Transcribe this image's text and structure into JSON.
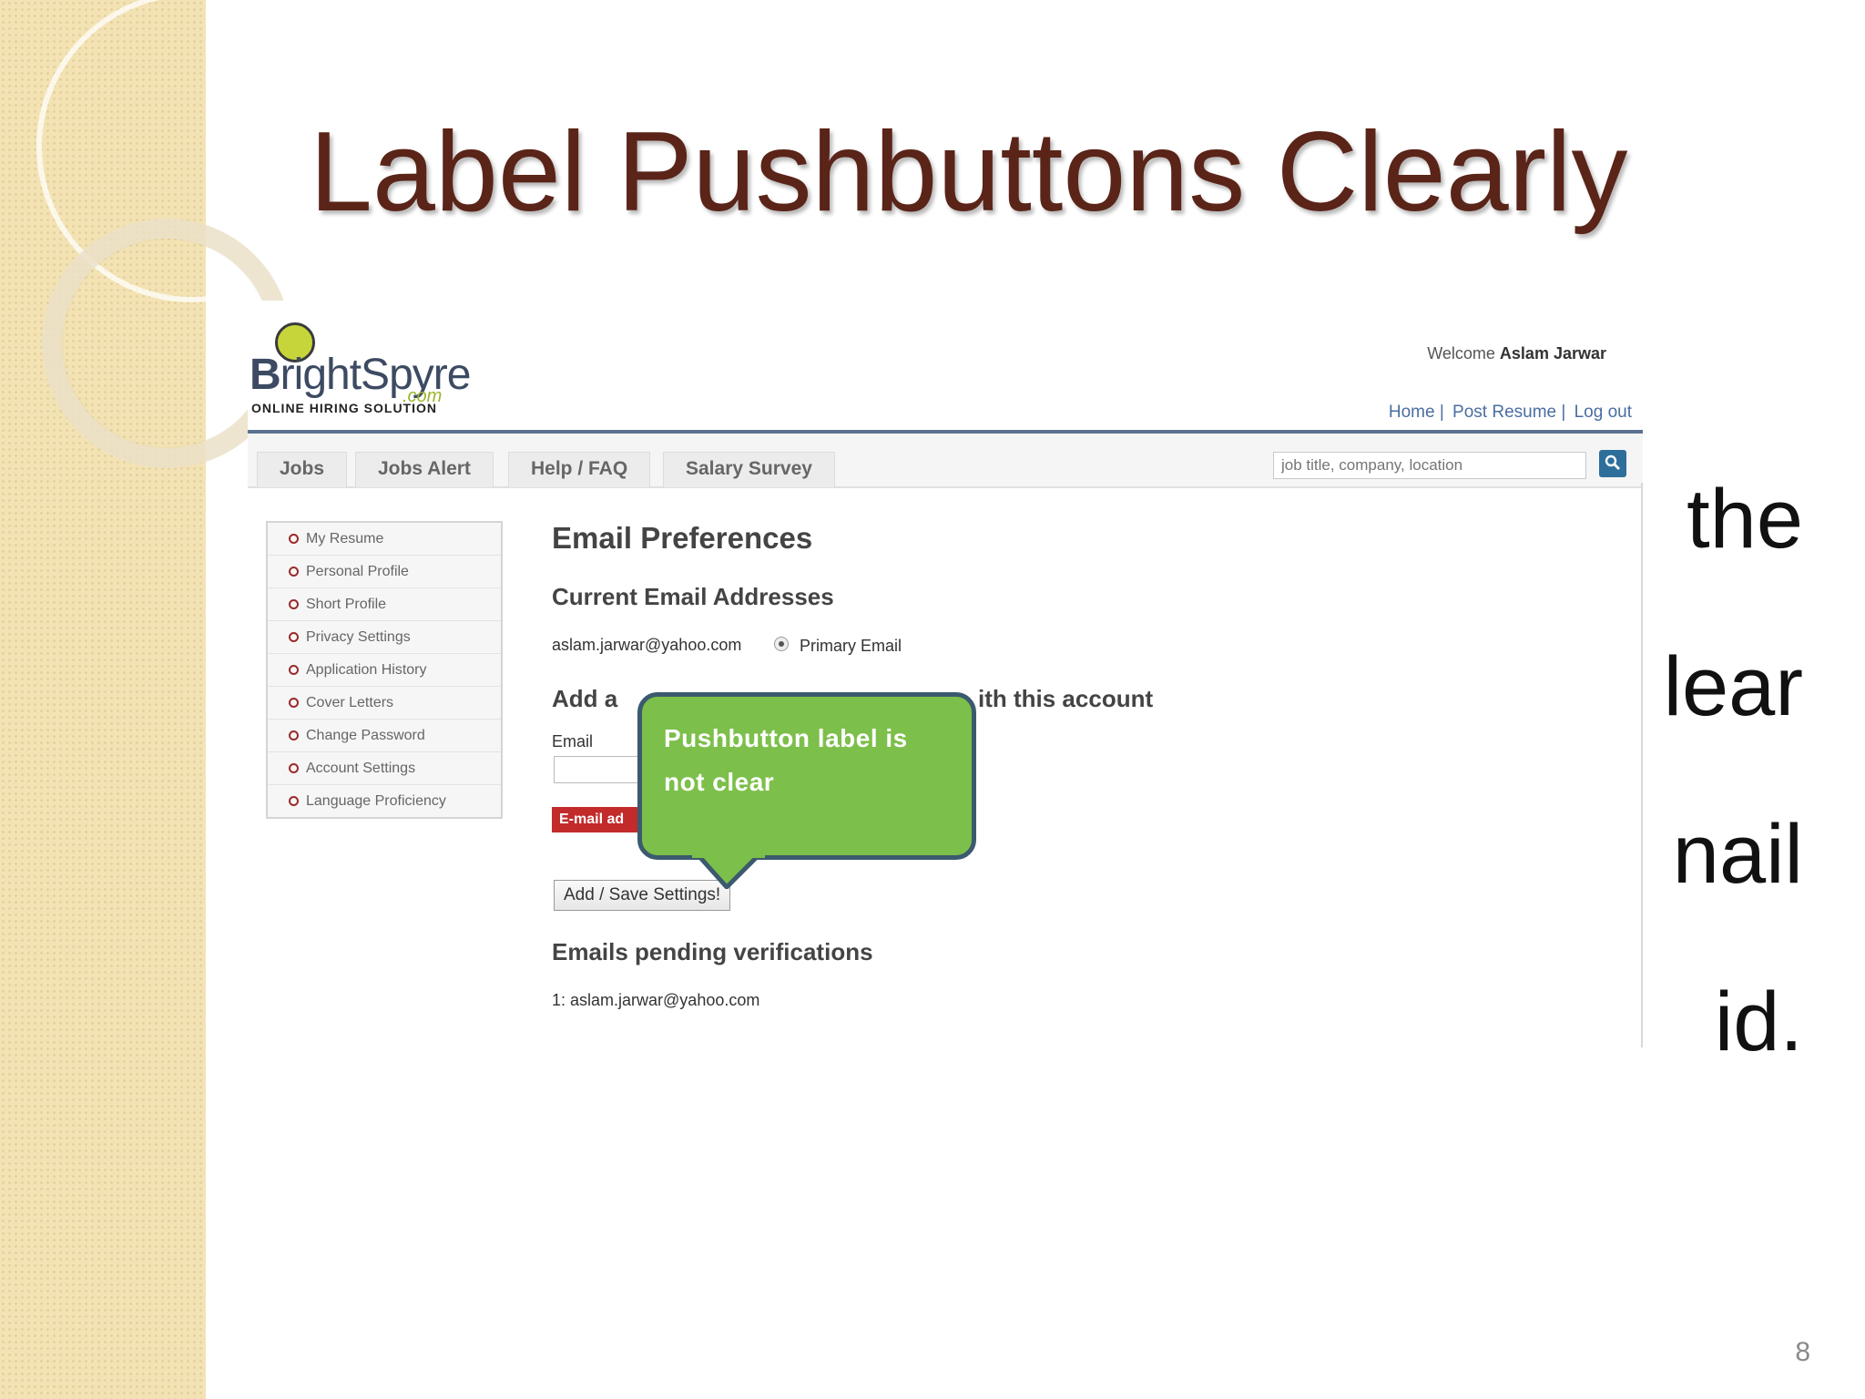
{
  "slide": {
    "title": "Label Pushbuttons Clearly",
    "bullet_fragments": [
      "the",
      "lear",
      "nail",
      "id."
    ],
    "page_number": "8"
  },
  "site": {
    "logo_text_first": "B",
    "logo_text_rest": "rightSpyre",
    "logo_com": ".com",
    "tagline": "ONLINE HIRING SOLUTION",
    "welcome_prefix": "Welcome",
    "user_name": "Aslam Jarwar",
    "top_links": [
      "Home |",
      "Post Resume |",
      "Log out"
    ],
    "tabs": [
      "Jobs",
      "Jobs Alert",
      "Help / FAQ",
      "Salary Survey"
    ],
    "search_placeholder": "job title, company, location",
    "sidebar_items": [
      "My Resume",
      "Personal Profile",
      "Short Profile",
      "Privacy Settings",
      "Application History",
      "Cover Letters",
      "Change Password",
      "Account Settings",
      "Language Proficiency"
    ]
  },
  "content": {
    "heading": "Email Preferences",
    "current_heading": "Current Email Addresses",
    "current_email": "aslam.jarwar@yahoo.com",
    "primary_label": "Primary Email",
    "add_heading_start": "Add a",
    "add_heading_end": "ith this account",
    "email_label": "Email",
    "red_button_label": "E-mail ad",
    "save_button_label": "Add / Save Settings!",
    "pending_heading": "Emails pending verifications",
    "pending_item": "1: aslam.jarwar@yahoo.com"
  },
  "callout": {
    "line1": "Pushbutton label is",
    "line2": "not clear"
  },
  "colors": {
    "title": "#5a2418",
    "callout_fill": "#7cbf4a",
    "callout_border": "#3b5a6e",
    "nav_rule": "#5a7290",
    "red_button": "#c32b2b"
  }
}
